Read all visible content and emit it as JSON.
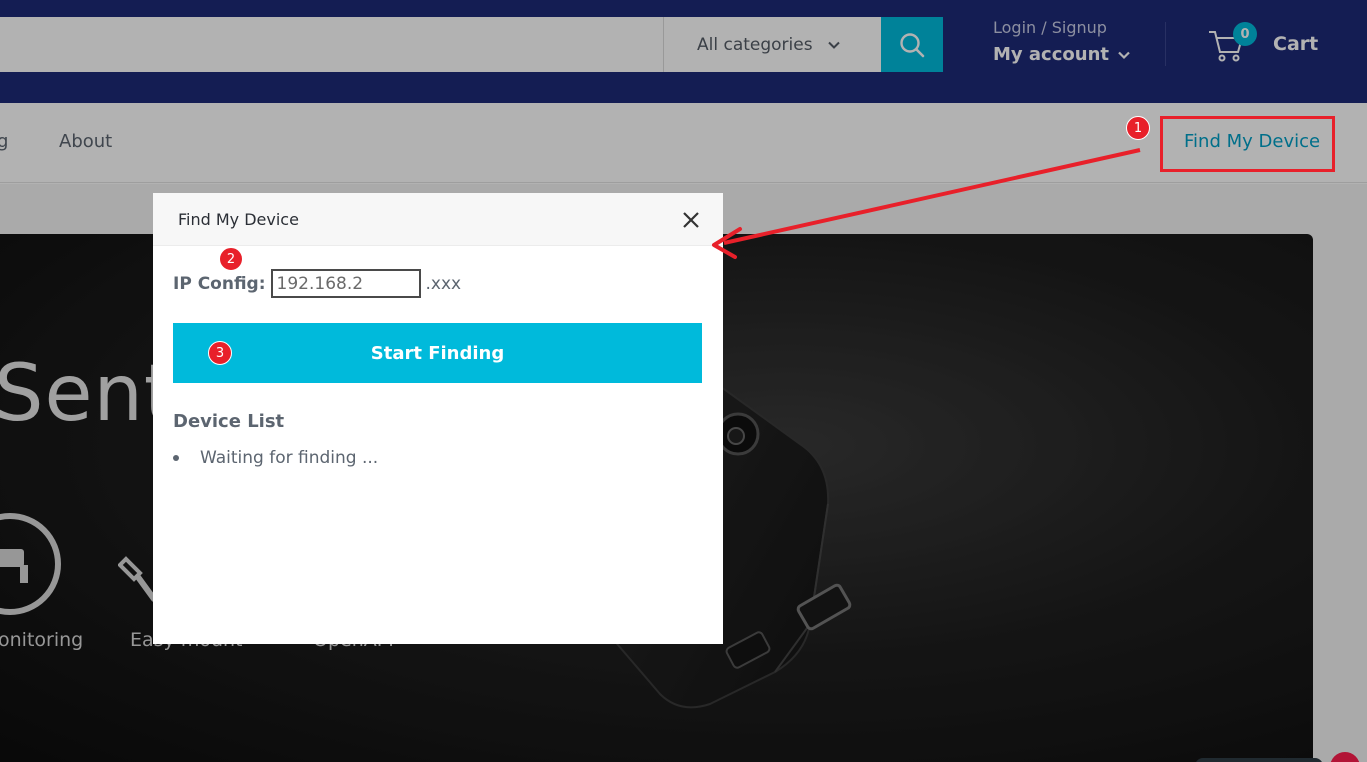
{
  "header": {
    "search_placeholder": "",
    "category_label": "All categories",
    "account_top": "Login / Signup",
    "account_main": "My account",
    "cart_count": "0",
    "cart_label": "Cart"
  },
  "nav": {
    "blog_partial": "og",
    "about": "About",
    "find_my_device": "Find My Device"
  },
  "hero": {
    "title_partial": "Sent",
    "features": [
      "onitoring",
      "Easy mount",
      "OpenAPI"
    ]
  },
  "modal": {
    "title": "Find My Device",
    "ip_label": "IP Config:",
    "ip_value": "192.168.2",
    "ip_suffix": ".xxx",
    "start_button": "Start Finding",
    "device_list_title": "Device List",
    "device_list_items": [
      "Waiting for finding ..."
    ]
  },
  "annotations": {
    "badge_1": "1",
    "badge_2": "2",
    "badge_3": "3",
    "color": "#e8202a"
  },
  "colors": {
    "header_bg": "#1e2a78",
    "accent": "#00badb",
    "nav_link_active": "#00a0c6"
  }
}
